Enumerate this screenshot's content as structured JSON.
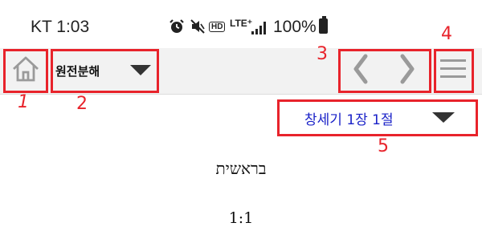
{
  "status_bar": {
    "carrier_time": "KT 1:03",
    "network": "LTE⁺",
    "hd_badge": "HD",
    "battery": "100%"
  },
  "toolbar": {
    "mode_label": "원전분해"
  },
  "chapter_selector": {
    "label": "창세기 1장 1절"
  },
  "content": {
    "book_title_hebrew": "בראשית",
    "verse_ref": "1:1"
  },
  "annotations": [
    "1",
    "2",
    "3",
    "4",
    "5"
  ],
  "colors": {
    "annotation": "#e8232b",
    "chapter_text": "#1a22c8",
    "toolbar_bg": "#f2f2f2"
  }
}
